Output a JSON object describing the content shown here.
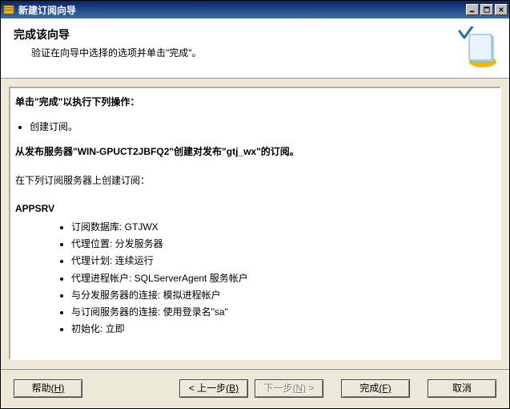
{
  "titlebar": {
    "title": "新建订阅向导"
  },
  "header": {
    "title": "完成该向导",
    "subtitle": "验证在向导中选择的选项并单击\"完成\"。"
  },
  "summary": {
    "intro": "单击\"完成\"以执行下列操作：",
    "create_action": "创建订阅。",
    "publisher_line": "从发布服务器\"WIN-GPUCT2JBFQ2\"创建对发布\"gtj_wx\"的订阅。",
    "subscribers_line": "在下列订阅服务器上创建订阅：",
    "server_name": "APPSRV",
    "details": [
      "订阅数据库: GTJWX",
      "代理位置: 分发服务器",
      "代理计划: 连续运行",
      "代理进程帐户: SQLServerAgent 服务帐户",
      "与分发服务器的连接: 模拟进程帐户",
      "与订阅服务器的连接: 使用登录名\"sa\"",
      "初始化: 立即"
    ]
  },
  "buttons": {
    "help": "帮助",
    "help_key": "(H)",
    "back": "< 上一步",
    "back_key": "(B)",
    "next": "下一步",
    "next_key": "(N)",
    "next_suffix": " >",
    "finish": "完成",
    "finish_key": "(F)",
    "cancel": "取消"
  }
}
